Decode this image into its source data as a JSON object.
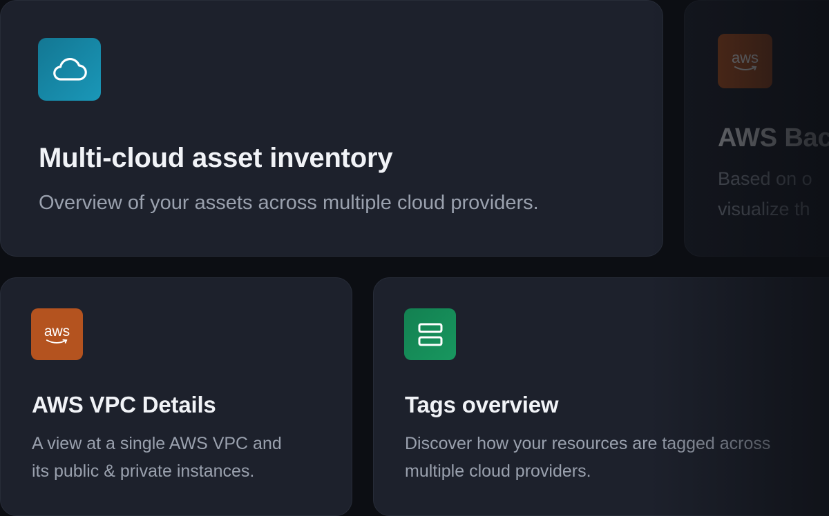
{
  "cards": [
    {
      "title": "Multi-cloud asset inventory",
      "description": "Overview of your assets across multiple cloud providers.",
      "icon": "cloud-icon"
    },
    {
      "title": "AWS Bac",
      "description_line1": "Based on o",
      "description_line2": "visualize th",
      "icon": "aws-logo-icon",
      "icon_text": "aws"
    },
    {
      "title": "AWS VPC Details",
      "description_line1": "A view at a single AWS VPC and",
      "description_line2": "its public & private instances.",
      "icon": "aws-logo-icon",
      "icon_text": "aws"
    },
    {
      "title": "Tags overview",
      "description_line1": "Discover how your resources are tagged across",
      "description_line2": "multiple cloud providers.",
      "icon": "tags-icon"
    }
  ],
  "colors": {
    "background": "#0c0e13",
    "card": "#1d212c",
    "cloud_tile": "#1a8fad",
    "aws_tile": "#b4531f",
    "tags_tile": "#16905a"
  }
}
